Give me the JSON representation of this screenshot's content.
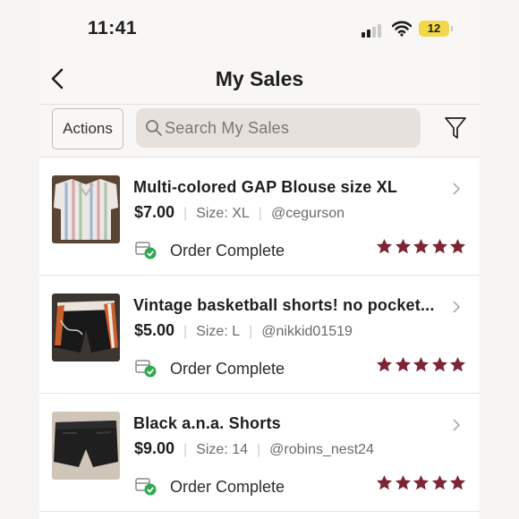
{
  "status_bar": {
    "time": "11:41",
    "battery": "12"
  },
  "header": {
    "title": "My Sales",
    "back_icon": "chevron-left-icon"
  },
  "toolbar": {
    "actions_label": "Actions",
    "search_placeholder": "Search My Sales",
    "filter_icon": "filter-icon"
  },
  "colors": {
    "star": "#7c2535",
    "check": "#2fa84f"
  },
  "sales": [
    {
      "title": "Multi-colored GAP Blouse size XL",
      "price": "$7.00",
      "size": "Size: XL",
      "buyer": "@cegurson",
      "status": "Order Complete",
      "rating": 5,
      "thumb_icon": "blouse-thumbnail"
    },
    {
      "title": "Vintage basketball shorts! no pocket...",
      "price": "$5.00",
      "size": "Size: L",
      "buyer": "@nikkid01519",
      "status": "Order Complete",
      "rating": 5,
      "thumb_icon": "basketball-shorts-thumbnail"
    },
    {
      "title": "Black a.n.a. Shorts",
      "price": "$9.00",
      "size": "Size: 14",
      "buyer": "@robins_nest24",
      "status": "Order Complete",
      "rating": 5,
      "thumb_icon": "black-shorts-thumbnail"
    }
  ]
}
